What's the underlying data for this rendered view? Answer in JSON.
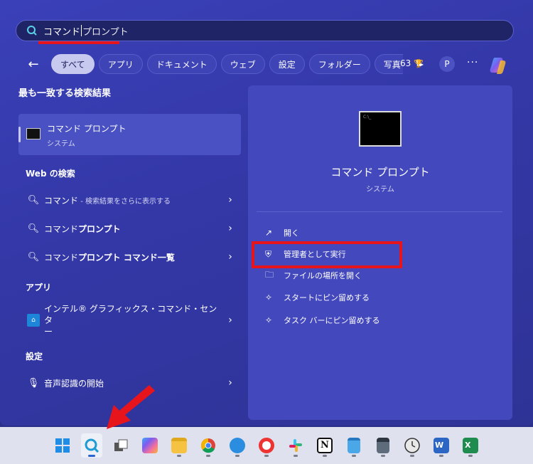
{
  "search": {
    "typed": "コマンド",
    "suggested": "プロンプト"
  },
  "filters": {
    "back": "←",
    "chips": [
      "すべて",
      "アプリ",
      "ドキュメント",
      "ウェブ",
      "設定",
      "フォルダー",
      "写真"
    ],
    "play": "▶",
    "rewards_count": "63",
    "rewards_icon": "🏆",
    "avatar": "P",
    "more": "···"
  },
  "left": {
    "best_match_title": "最も一致する検索結果",
    "best_match": {
      "name": "コマンド プロンプト",
      "sub": "システム"
    },
    "web_title": "Web の検索",
    "web_items": [
      {
        "prefix": "コマンド",
        "muted": " - 検索結果をさらに表示する",
        "suffix": ""
      },
      {
        "prefix": "コマンド",
        "muted": "",
        "suffix": "プロンプト"
      },
      {
        "prefix": "コマンド",
        "muted": "",
        "suffix": "プロンプト コマンド一覧"
      }
    ],
    "apps_title": "アプリ",
    "app_item": {
      "name": "インテル® グラフィックス・コマンド・センタ",
      "name2": "ー"
    },
    "settings_title": "設定",
    "settings_item": {
      "name": "音声認識の開始"
    }
  },
  "right": {
    "icon_text": "C:\\_",
    "title": "コマンド プロンプト",
    "sub": "システム",
    "actions": [
      "開く",
      "管理者として実行",
      "ファイルの場所を開く",
      "スタートにピン留めする",
      "タスク バーにピン留めする"
    ]
  },
  "colors": {
    "highlight_red": "#e8141c",
    "panel": "#3a40b8"
  }
}
